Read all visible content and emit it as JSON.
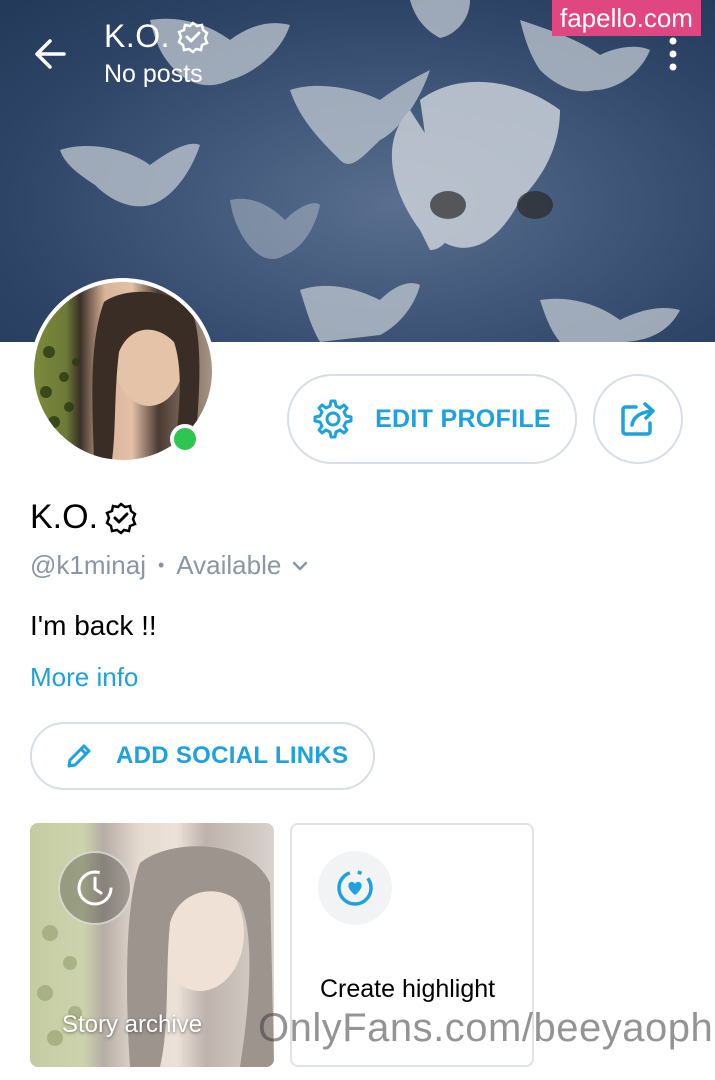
{
  "watermark_top": "fapello.com",
  "header": {
    "name": "K.O.",
    "subtitle": "No posts"
  },
  "profile": {
    "name": "K.O.",
    "handle": "@k1minaj",
    "separator": "•",
    "status": "Available",
    "bio": "I'm back !!",
    "more_info": "More info"
  },
  "buttons": {
    "edit_profile": "EDIT PROFILE",
    "add_social_links": "ADD SOCIAL LINKS"
  },
  "cards": {
    "story_archive": "Story archive",
    "create_highlight": "Create highlight"
  },
  "watermark_bottom": "OnlyFans.com/beeyaoph",
  "colors": {
    "accent": "#1ea1dc",
    "online": "#2ec551",
    "muted": "#8a96a3",
    "border": "#d8dee6"
  },
  "icons": {
    "back": "arrow-left-icon",
    "verified": "verified-badge-icon",
    "menu": "kebab-menu-icon",
    "settings": "gear-icon",
    "share": "share-icon",
    "dropdown": "chevron-down-icon",
    "edit": "pencil-icon",
    "archive": "clock-icon",
    "highlight": "heart-circle-icon"
  }
}
